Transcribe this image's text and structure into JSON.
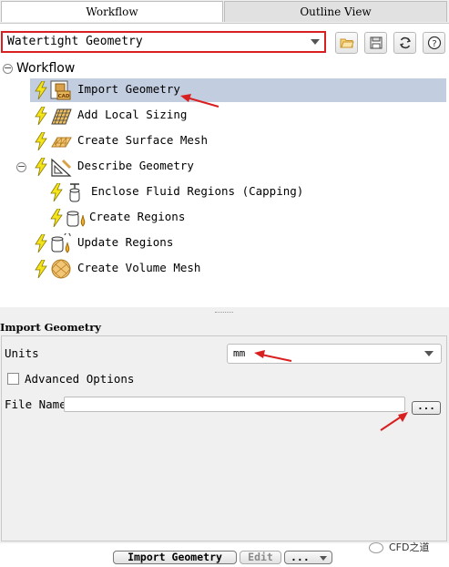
{
  "tabs": [
    {
      "label": "Workflow",
      "active": true
    },
    {
      "label": "Outline View",
      "active": false
    }
  ],
  "workflow_select": {
    "value": "Watertight Geometry"
  },
  "toolbar_icons": [
    "open-folder-icon",
    "save-icon",
    "refresh-icon",
    "help-icon"
  ],
  "tree": {
    "root_label": "Workflow",
    "items": [
      {
        "label": "Import Geometry",
        "icon": "cad-import-icon",
        "selected": true
      },
      {
        "label": "Add Local Sizing",
        "icon": "local-sizing-icon"
      },
      {
        "label": "Create Surface Mesh",
        "icon": "surface-mesh-icon"
      },
      {
        "label": "Describe Geometry",
        "icon": "describe-geometry-icon",
        "collapsible": true
      },
      {
        "label": "Enclose Fluid Regions (Capping)",
        "icon": "capping-icon"
      },
      {
        "label": "Create Regions",
        "icon": "create-regions-icon"
      },
      {
        "label": "Update Regions",
        "icon": "update-regions-icon"
      },
      {
        "label": "Create Volume Mesh",
        "icon": "volume-mesh-icon"
      }
    ]
  },
  "properties": {
    "title": "Import Geometry",
    "units_label": "Units",
    "units_value": "mm",
    "advanced_label": "Advanced Options",
    "file_name_label": "File Name",
    "file_name_value": "",
    "browse_label": "..."
  },
  "bottom_buttons": {
    "import": "Import Geometry",
    "edit": "Edit",
    "more": "..."
  },
  "watermark": "CFD之道",
  "colors": {
    "highlight": "#d92020",
    "selection": "#c2cde0",
    "bolt": "#f5e41a"
  }
}
